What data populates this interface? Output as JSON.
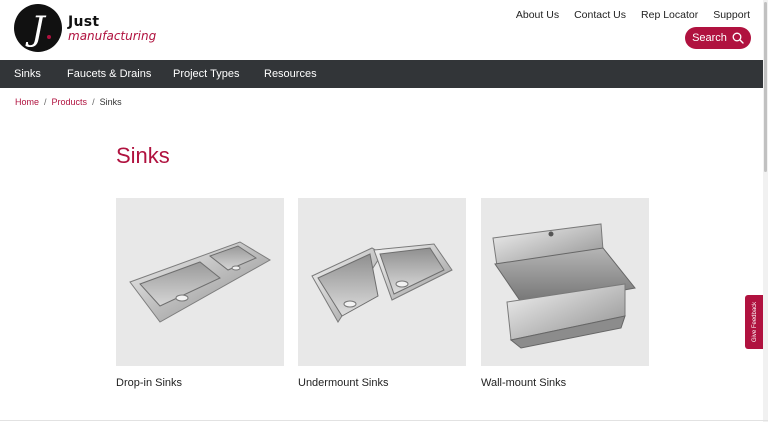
{
  "brand": {
    "name": "Just",
    "tagline": "manufacturing",
    "logo_glyph": "J",
    "accent_color": "#b0123f",
    "nav_bg_color": "#323538"
  },
  "utility_nav": [
    {
      "label": "About Us"
    },
    {
      "label": "Contact Us"
    },
    {
      "label": "Rep Locator"
    },
    {
      "label": "Support"
    }
  ],
  "search": {
    "label": "Search",
    "icon": "search-icon"
  },
  "main_nav": [
    {
      "label": "Sinks"
    },
    {
      "label": "Faucets & Drains"
    },
    {
      "label": "Project Types"
    },
    {
      "label": "Resources"
    }
  ],
  "breadcrumb": {
    "home": "Home",
    "products": "Products",
    "current": "Sinks",
    "separator": "/"
  },
  "page": {
    "title": "Sinks"
  },
  "products": [
    {
      "label": "Drop-in Sinks",
      "image": "drop-in-sink-image"
    },
    {
      "label": "Undermount Sinks",
      "image": "undermount-sink-image"
    },
    {
      "label": "Wall-mount Sinks",
      "image": "wall-mount-sink-image"
    }
  ],
  "feedback": {
    "label": "Give Feedback"
  }
}
